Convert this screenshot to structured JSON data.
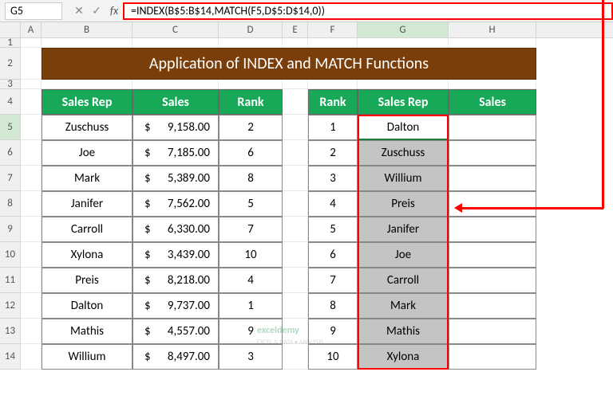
{
  "namebox": "G5",
  "formula": "=INDEX(B$5:B$14,MATCH(F5,D$5:D$14,0))",
  "columns": [
    "A",
    "B",
    "C",
    "D",
    "E",
    "F",
    "G",
    "H"
  ],
  "rows": [
    "1",
    "2",
    "3",
    "4",
    "5",
    "6",
    "7",
    "8",
    "9",
    "10",
    "11",
    "12",
    "13",
    "14"
  ],
  "title": "Application of INDEX and MATCH Functions",
  "left_headers": {
    "rep": "Sales Rep",
    "sales": "Sales",
    "rank": "Rank"
  },
  "right_headers": {
    "rank": "Rank",
    "rep": "Sales Rep",
    "sales": "Sales"
  },
  "left_data": [
    {
      "rep": "Zuschuss",
      "sales": "9,158.00",
      "rank": "2"
    },
    {
      "rep": "Joe",
      "sales": "7,185.00",
      "rank": "6"
    },
    {
      "rep": "Mark",
      "sales": "5,389.00",
      "rank": "8"
    },
    {
      "rep": "Janifer",
      "sales": "7,562.00",
      "rank": "5"
    },
    {
      "rep": "Carroll",
      "sales": "6,330.00",
      "rank": "7"
    },
    {
      "rep": "Xylona",
      "sales": "3,439.00",
      "rank": "10"
    },
    {
      "rep": "Preis",
      "sales": "8,218.00",
      "rank": "4"
    },
    {
      "rep": "Dalton",
      "sales": "9,737.00",
      "rank": "1"
    },
    {
      "rep": "Mathis",
      "sales": "4,557.00",
      "rank": "9"
    },
    {
      "rep": "Willium",
      "sales": "8,497.00",
      "rank": "3"
    }
  ],
  "right_data": [
    {
      "rank": "1",
      "rep": "Dalton"
    },
    {
      "rank": "2",
      "rep": "Zuschuss"
    },
    {
      "rank": "3",
      "rep": "Willium"
    },
    {
      "rank": "4",
      "rep": "Preis"
    },
    {
      "rank": "5",
      "rep": "Janifer"
    },
    {
      "rank": "6",
      "rep": "Joe"
    },
    {
      "rank": "7",
      "rep": "Carroll"
    },
    {
      "rank": "8",
      "rep": "Mark"
    },
    {
      "rank": "9",
      "rep": "Mathis"
    },
    {
      "rank": "10",
      "rep": "Xylona"
    }
  ],
  "watermark": {
    "main": "exceldemy",
    "sub": "EXCEL & DATA • ANALYSIS"
  },
  "dollar": "$"
}
